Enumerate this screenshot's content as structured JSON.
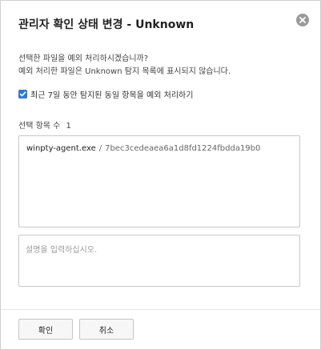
{
  "dialog": {
    "title": "관리자 확인 상태 변경 - Unknown",
    "close_icon": "close-circle-icon",
    "message_line1": "선택한 파일을 예외 처리하시겠습니까?",
    "message_line2": "예외 처리한 파일은 Unknown 탐지 목록에 표시되지 않습니다.",
    "checkbox": {
      "label": "최근 7일 동안 탐지된 동일 항목을 예외 처리하기",
      "checked": true
    },
    "selected_count_label": "선택 항목 수",
    "selected_count": "1",
    "items": [
      {
        "name": "winpty-agent.exe",
        "separator": "/",
        "hash": "7bec3cedeaea6a1d8fd1224fbdda19b0"
      }
    ],
    "description": {
      "placeholder": "설명을 입력하십시오.",
      "value": ""
    },
    "buttons": {
      "confirm_label": "확인",
      "cancel_label": "취소"
    },
    "colors": {
      "checkbox_accent": "#2f78d6",
      "close_icon": "#9a9a9a"
    }
  }
}
